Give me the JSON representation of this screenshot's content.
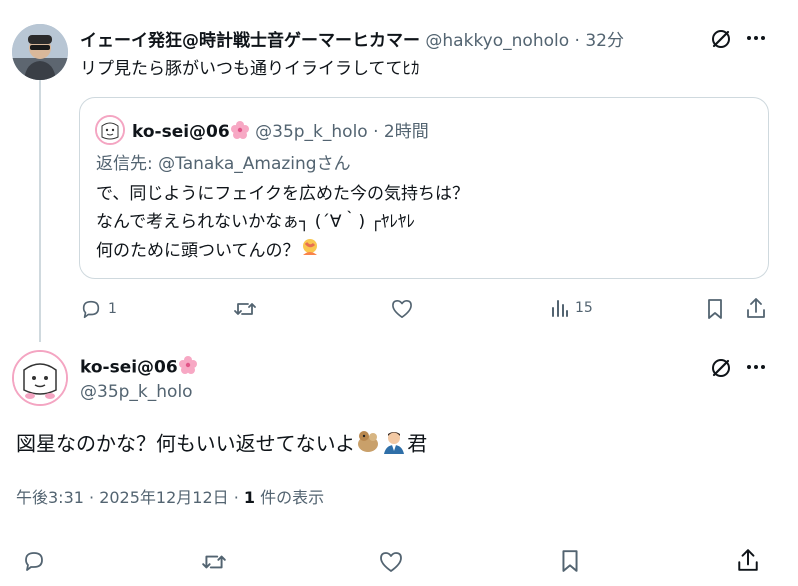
{
  "parent_tweet": {
    "display_name": "イェーイ発狂@時計戦士音ゲーマーヒカマー",
    "handle": "@hakkyo_noholo",
    "time": "32分",
    "text": "リプ見たら豚がいつも通りイライラしててﾋｶ",
    "quote": {
      "display_name": "ko-sei@06",
      "handle": "@35p_k_holo",
      "time": "2時間",
      "reply_to": "返信先: @Tanaka_Amazingさん",
      "lines": [
        "で、同じようにフェイクを広めた今の気持ちは？",
        "なんで考えられないかなぁ┐ (´∀｀) ┌ﾔﾚﾔﾚ",
        "何のために頭ついてんの？"
      ]
    },
    "actions": {
      "reply_count": "1",
      "views_count": "15"
    }
  },
  "main_tweet": {
    "display_name": "ko-sei@06",
    "handle": "@35p_k_holo",
    "text_prefix": "図星なのかな？何もいい返せてないよ",
    "text_suffix": "君",
    "meta_time": "午後3:31 · 2025年12月12日 · ",
    "meta_count": "1",
    "meta_suffix": " 件の表示"
  },
  "icons": [
    "grok-icon",
    "more-icon",
    "reply-icon",
    "retweet-icon",
    "like-icon",
    "views-icon",
    "bookmark-icon",
    "share-icon",
    "sakura-emoji",
    "facepalm-emoji",
    "dog-emoji",
    "man-emoji"
  ],
  "colors": {
    "text": "#0f1419",
    "muted": "#536471",
    "border": "#cfd9de",
    "pink": "#f4a5c2"
  }
}
